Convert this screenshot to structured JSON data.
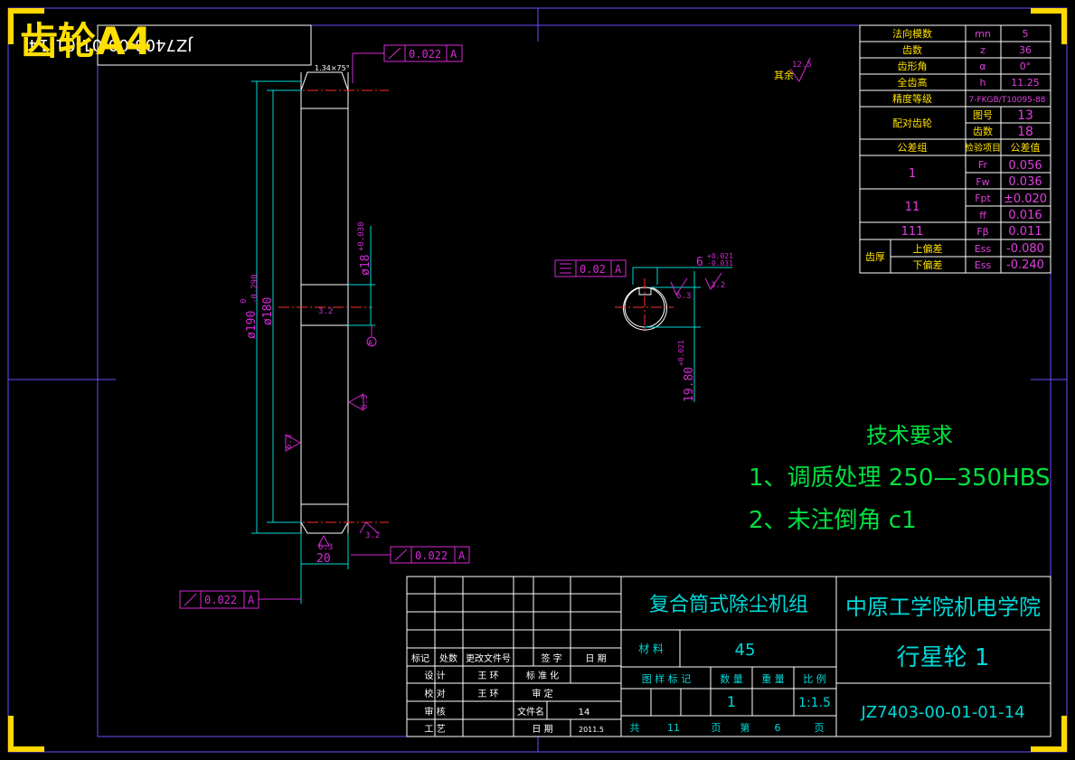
{
  "header": {
    "sheet_label": "齿轮A4",
    "code_box": "JZ7403-00-01-01-14"
  },
  "gear_params": {
    "rows": [
      {
        "name": "法向模数",
        "sym": "mn",
        "val": "5"
      },
      {
        "name": "齿数",
        "sym": "z",
        "val": "36"
      },
      {
        "name": "齿形角",
        "sym": "α",
        "val": "0°"
      },
      {
        "name": "全齿高",
        "sym": "h",
        "val": "11.25"
      }
    ],
    "accuracy_label": "精度等级",
    "accuracy_value": "7-FKGB/T10095-88",
    "mate_label": "配对齿轮",
    "mate_drawing_label": "图号",
    "mate_drawing_value": "13",
    "mate_teeth_label": "齿数",
    "mate_teeth_value": "18",
    "tol_group_label": "公差组",
    "check_item_label": "检验项目",
    "tol_value_label": "公差值",
    "group1": "1",
    "fr_sym": "Fr",
    "fr_val": "0.056",
    "fw_sym": "Fw",
    "fw_val": "0.036",
    "group2": "11",
    "fpt_sym": "Fpt",
    "fpt_val": "±0.020",
    "ff_sym": "ff",
    "ff_val": "0.016",
    "group3": "111",
    "fb_sym": "Fβ",
    "fb_val": "0.011",
    "thick_label": "齿厚",
    "upper_label": "上偏差",
    "ess_sym": "Ess",
    "upper_val": "-0.080",
    "lower_label": "下偏差",
    "esi_sym": "Ess",
    "lower_val": "-0.240"
  },
  "drawing": {
    "chamfer": "1.34×75°",
    "rest_rough": "其余",
    "rest_rough_val": "12.5",
    "tol_top": "0.022",
    "tol_mid": "0.022",
    "tol_left": "0.022",
    "datum": "A",
    "dia_outer": "ø190",
    "dia_outer_tol_up": "0",
    "dia_outer_tol_dn": "-0.290",
    "dia_pitch": "ø180",
    "dia_bore": "ø18",
    "dia_bore_tol": "+0.030",
    "bore_rough": "3.2",
    "face_rough_r": "6.3",
    "face_rough_l": "6.3",
    "bot_rough_1": "3.2",
    "bot_rough_2": "6.3",
    "width": "20",
    "sym_tol": "0.02",
    "key_width": "6",
    "key_tol_up": "+0.021",
    "key_tol_dn": "-0.031",
    "key_rough_1": "6.3",
    "key_rough_2": "3.2",
    "key_depth": "19.80",
    "key_depth_tol": "+0.021"
  },
  "requirements": {
    "title": "技术要求",
    "item1": "1、调质处理 250—350HBS",
    "item2": "2、未注倒角 c1"
  },
  "title_block": {
    "project": "复合筒式除尘机组",
    "school": "中原工学院机电学院",
    "material_label": "材 料",
    "material": "45",
    "part_name": "行星轮  1",
    "stage_label": "图 样 标 记",
    "qty_label": "数 量",
    "weight_label": "重 量",
    "scale_label": "比 例",
    "qty": "1",
    "scale": "1:1.5",
    "drawing_no": "JZ7403-00-01-01-14",
    "total_label": "共",
    "total_pages": "11",
    "page_label": "页",
    "sheet_label": "第",
    "sheet_no": "6",
    "sheet_suffix": "页",
    "rev_headers": [
      "标记",
      "处数",
      "更改文件号",
      "签   字",
      "日 期"
    ],
    "design_label": "设  计",
    "design_name": "王 环",
    "std_label": "标  准  化",
    "check_label": "校  对",
    "check_name": "王 环",
    "review_label": "审  定",
    "audit_label": "审  核",
    "file_label": "文件名",
    "file_value": "14",
    "process_label": "工  艺",
    "date_label": "日  期",
    "date_value": "2011.5"
  }
}
